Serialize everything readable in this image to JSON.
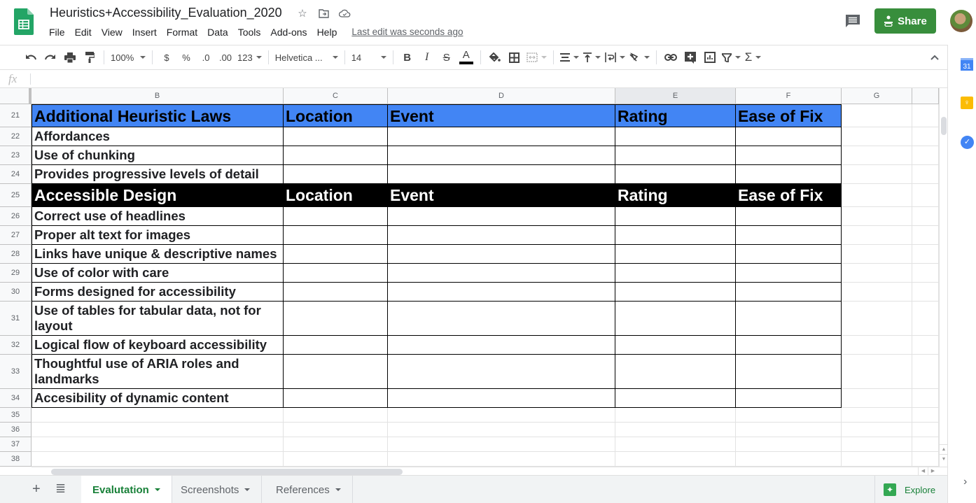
{
  "app": {
    "doc_title": "Heuristics+Accessibility_Evaluation_2020",
    "title_icons": [
      "star-icon",
      "move-to-folder-icon",
      "cloud-saved-icon"
    ],
    "menu": [
      "File",
      "Edit",
      "View",
      "Insert",
      "Format",
      "Data",
      "Tools",
      "Add-ons",
      "Help"
    ],
    "last_edit": "Last edit was seconds ago",
    "share_label": "Share",
    "brand_color": "#188038",
    "share_color": "#388e3c"
  },
  "toolbar": {
    "zoom": "100%",
    "currency": "$",
    "percent": "%",
    "dec_decrease": ".0",
    "dec_increase": ".00",
    "more_formats": "123",
    "font": "Helvetica ...",
    "font_size": "14",
    "bold": "B",
    "italic": "I",
    "strike": "S",
    "text_color": "A",
    "sum": "Σ"
  },
  "formula_bar": {
    "fx_label": "fx",
    "value": ""
  },
  "grid": {
    "columns": [
      "B",
      "C",
      "D",
      "E",
      "F",
      "G",
      ""
    ],
    "selected_column": "E",
    "rows": [
      {
        "num": "21",
        "style": "h-blue",
        "cells": [
          "Additional Heuristic Laws",
          "Location",
          "Event",
          "Rating",
          "Ease of Fix"
        ]
      },
      {
        "num": "22",
        "style": "body",
        "cells": [
          "Affordances",
          "",
          "",
          "",
          ""
        ]
      },
      {
        "num": "23",
        "style": "body",
        "cells": [
          "Use of chunking",
          "",
          "",
          "",
          ""
        ]
      },
      {
        "num": "24",
        "style": "body",
        "cells": [
          "Provides progressive levels of detail",
          "",
          "",
          "",
          ""
        ]
      },
      {
        "num": "25",
        "style": "h-black",
        "cells": [
          "Accessible Design",
          "Location",
          "Event",
          "Rating",
          "Ease of Fix"
        ]
      },
      {
        "num": "26",
        "style": "body",
        "cells": [
          "Correct use of headlines",
          "",
          "",
          "",
          ""
        ]
      },
      {
        "num": "27",
        "style": "body",
        "cells": [
          "Proper alt text for images",
          "",
          "",
          "",
          ""
        ]
      },
      {
        "num": "28",
        "style": "body",
        "cells": [
          "Links have unique & descriptive names",
          "",
          "",
          "",
          ""
        ]
      },
      {
        "num": "29",
        "style": "body",
        "cells": [
          "Use of color with care",
          "",
          "",
          "",
          ""
        ]
      },
      {
        "num": "30",
        "style": "body",
        "cells": [
          "Forms designed for accessibility",
          "",
          "",
          "",
          ""
        ]
      },
      {
        "num": "31",
        "style": "body",
        "cells": [
          "Use of tables for tabular data, not for layout",
          "",
          "",
          "",
          ""
        ]
      },
      {
        "num": "32",
        "style": "body",
        "cells": [
          "Logical flow of keyboard accessibility",
          "",
          "",
          "",
          ""
        ]
      },
      {
        "num": "33",
        "style": "body",
        "cells": [
          "Thoughtful use of ARIA roles and landmarks",
          "",
          "",
          "",
          ""
        ]
      },
      {
        "num": "34",
        "style": "body",
        "cells": [
          "Accesibility of dynamic content",
          "",
          "",
          "",
          ""
        ]
      },
      {
        "num": "35",
        "style": "empty",
        "cells": []
      },
      {
        "num": "36",
        "style": "empty",
        "cells": []
      },
      {
        "num": "37",
        "style": "empty",
        "cells": []
      },
      {
        "num": "38",
        "style": "empty",
        "cells": []
      }
    ],
    "header_blue": "#4285f4",
    "header_black": "#000000"
  },
  "sheets": {
    "tabs": [
      {
        "label": "Evalutation",
        "active": true
      },
      {
        "label": "Screenshots",
        "active": false
      },
      {
        "label": "References",
        "active": false
      }
    ],
    "explore_label": "Explore"
  },
  "side_panel": {
    "calendar_day": "31",
    "items": [
      "calendar-icon",
      "keep-icon",
      "tasks-icon"
    ]
  }
}
